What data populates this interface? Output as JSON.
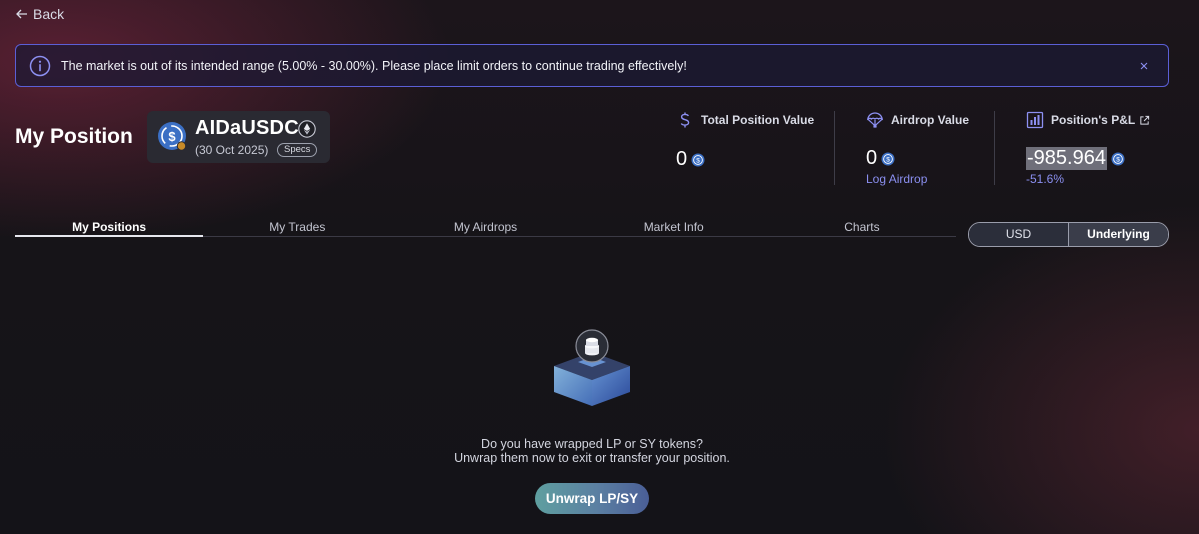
{
  "nav": {
    "back_label": "Back"
  },
  "alert": {
    "message": "The market is out of its intended range (5.00% - 30.00%). Please place limit orders to continue trading effectively!"
  },
  "page": {
    "title": "My Position"
  },
  "token": {
    "name": "AIDaUSDC",
    "date": "(30 Oct 2025)",
    "specs_label": "Specs",
    "icon": "usdc-coin-icon",
    "network_icon": "ethereum-icon"
  },
  "stats": {
    "total_position": {
      "label": "Total Position Value",
      "value": "0",
      "icon": "dollar-icon"
    },
    "airdrop": {
      "label": "Airdrop Value",
      "value": "0",
      "link": "Log Airdrop",
      "icon": "parachute-icon"
    },
    "pnl": {
      "label": "Position's P&L",
      "value": "-985.964",
      "change": "-51.6%",
      "icon": "chart-icon"
    }
  },
  "tabs": [
    {
      "label": "My Positions",
      "active": true
    },
    {
      "label": "My Trades"
    },
    {
      "label": "My Airdrops"
    },
    {
      "label": "Market Info"
    },
    {
      "label": "Charts"
    }
  ],
  "currency_toggle": {
    "usd": "USD",
    "underlying": "Underlying",
    "selected": "Underlying"
  },
  "empty_state": {
    "line1": "Do you have wrapped LP or SY tokens?",
    "line2": "Unwrap them now to exit or transfer your position.",
    "button": "Unwrap LP/SY"
  },
  "colors": {
    "accent": "#5b5fd6",
    "link": "#8b8ff0",
    "coin": "#3b6fc4"
  }
}
